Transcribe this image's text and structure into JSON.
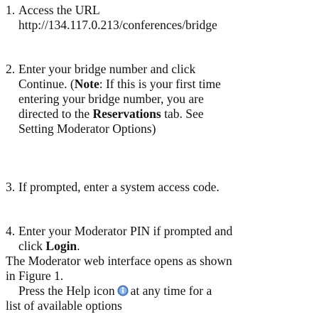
{
  "steps": [
    {
      "number": "1.",
      "lines": [
        "Access the URL",
        "http://134.117.0.213/conferences/bridge"
      ]
    },
    {
      "number": "2.",
      "line1": "Enter your bridge number and click",
      "line2_pre": "Continue. (",
      "line2_bold": "Note",
      "line2_post": ": If this is your first time",
      "line3": "entering your bridge number, you are",
      "line4_pre": "directed to the ",
      "line4_bold": "Reservations",
      "line4_post": " tab. See",
      "line5": "Setting Moderator Options)"
    },
    {
      "number": "3.",
      "lines": [
        "If prompted, enter a system access code."
      ]
    },
    {
      "number": "4.",
      "line1": "Enter your Moderator PIN if prompted and",
      "line2_pre": "click ",
      "line2_bold": "Login",
      "line2_post": "."
    }
  ],
  "after": {
    "line1": "The Moderator web interface opens as shown",
    "line2": "in Figure 1.",
    "help_pre": "Press the Help icon",
    "help_post": "at any time for a",
    "help_line2": "list of available options"
  },
  "icons": {
    "help": "help-icon"
  },
  "colors": {
    "text": "#111111",
    "icon_blue": "#5b8fd6"
  }
}
